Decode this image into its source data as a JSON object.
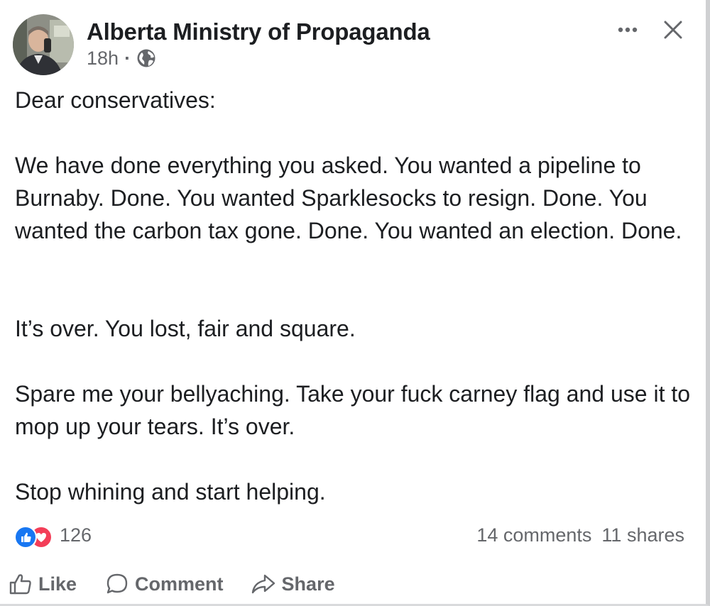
{
  "post": {
    "page_name": "Alberta Ministry of Propaganda",
    "time": "18h",
    "separator": "·",
    "audience_icon": "globe-icon",
    "more_icon": "more-horizontal-icon",
    "close_icon": "close-icon",
    "paragraphs": [
      "Dear conservatives:",
      "We have done everything you asked. You wanted a pipeline to Burnaby. Done. You wanted Sparklesocks to resign. Done. You wanted the carbon tax gone. Done. You wanted an election. Done.",
      "It’s over. You lost, fair and square.",
      "Spare me your bellyaching. Take your fuck carney flag and use it to mop up your tears. It’s over.",
      "Stop whining and start helping."
    ]
  },
  "stats": {
    "reaction_count": "126",
    "comments": "14 comments",
    "shares": "11 shares"
  },
  "actions": {
    "like_label": "Like",
    "comment_label": "Comment",
    "share_label": "Share"
  },
  "colors": {
    "text": "#1c1e21",
    "secondary": "#65676b",
    "like_blue": "#1877f2",
    "love_red": "#f33e58"
  }
}
